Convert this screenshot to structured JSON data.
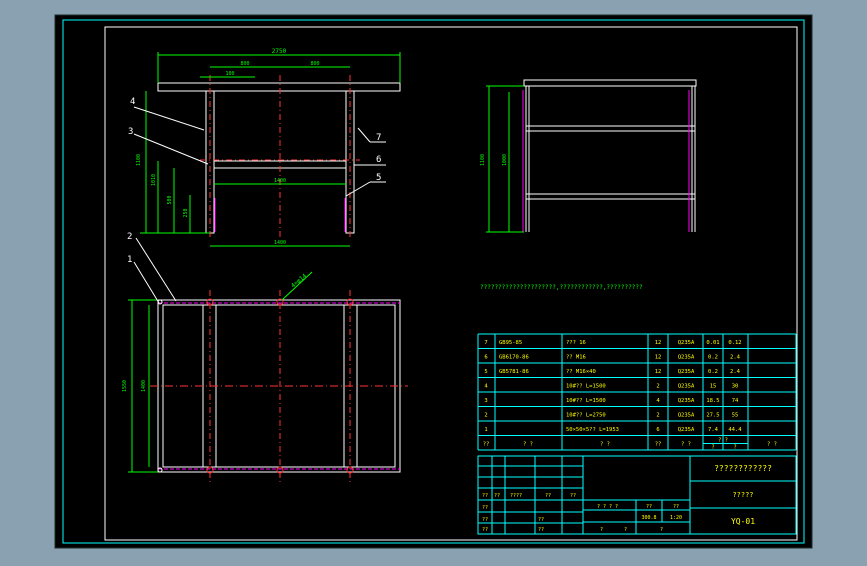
{
  "colors": {
    "viewport_bg": "#8aa1b1",
    "drawing_bg": "#000000",
    "frame": "#ffffff",
    "dimension": "#00ff00",
    "table_text": "#ffff00",
    "centerline": "#ff3333",
    "hidden": "#ff00ff",
    "leader": "#ffffff",
    "title_frame": "#00ffff"
  },
  "front_view": {
    "dims": {
      "overall_width": "2750",
      "span_left": "800",
      "span_right": "800",
      "span_small": "100",
      "height_total": "1100",
      "height_mid": "1010",
      "height_lower": "500",
      "height_foot": "250",
      "inner_width": "1400",
      "bottom_width": "1400"
    },
    "callouts": [
      "4",
      "3",
      "7",
      "6",
      "5"
    ]
  },
  "side_view": {
    "dims": {
      "height_outer": "1100",
      "height_inner": "1000"
    }
  },
  "top_view": {
    "dims": {
      "depth_outer": "1550",
      "depth_inner": "1400",
      "hole_label": "4×φ14"
    },
    "callouts": [
      "2",
      "1"
    ]
  },
  "tech_note": "?????????????????????,????????????,??????????",
  "parts_table": {
    "rows": [
      {
        "no": "7",
        "std": "GB95-85",
        "name": "??? 16",
        "qty": "12",
        "mat": "Q235A",
        "w1": "0.01",
        "w2": "0.12"
      },
      {
        "no": "6",
        "std": "GB6170-86",
        "name": "?? M16",
        "qty": "12",
        "mat": "Q235A",
        "w1": "0.2",
        "w2": "2.4"
      },
      {
        "no": "5",
        "std": "GB5781-86",
        "name": "?? M16×40",
        "qty": "12",
        "mat": "Q235A",
        "w1": "0.2",
        "w2": "2.4"
      },
      {
        "no": "4",
        "std": "",
        "name": "10#?? L=1500",
        "qty": "2",
        "mat": "Q235A",
        "w1": "15",
        "w2": "30"
      },
      {
        "no": "3",
        "std": "",
        "name": "10#?? L=1500",
        "qty": "4",
        "mat": "Q235A",
        "w1": "18.5",
        "w2": "74"
      },
      {
        "no": "2",
        "std": "",
        "name": "10#?? L=2750",
        "qty": "2",
        "mat": "Q235A",
        "w1": "27.5",
        "w2": "55"
      },
      {
        "no": "1",
        "std": "",
        "name": "50×50×5?? L=1953",
        "qty": "6",
        "mat": "Q235A",
        "w1": "7.4",
        "w2": "44.4"
      }
    ],
    "header": {
      "no": "??",
      "std": "?  ?",
      "name": "?  ?",
      "qty": "??",
      "mat": "?  ?",
      "w_top": "? ?",
      "w1": "?",
      "w2": "?",
      "remark": "?  ?"
    }
  },
  "title_block": {
    "title": "????????????",
    "subtitle": "?????",
    "drawing_no": "YQ-01",
    "scale_text": "? ? ? ?",
    "scale": "1:1",
    "sheet": "?",
    "count_a": "??",
    "count_b": "??",
    "cells": {
      "r1a": "??",
      "r1b": "??",
      "r1c": "????",
      "r1d": "??",
      "r2a": "??",
      "r2b": "??",
      "r3a": "??",
      "r3b": "??",
      "r4a": "??",
      "r4b": "??",
      "weight": "300.8",
      "scale2": "1:20",
      "sh1": "?",
      "sh2": "?",
      "sh3": "?"
    }
  }
}
